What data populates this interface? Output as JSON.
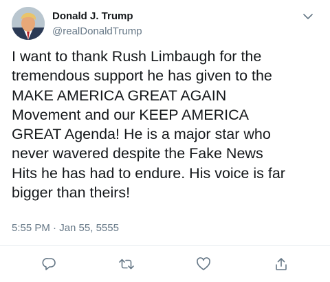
{
  "tweet": {
    "author": {
      "name": "Donald J. Trump",
      "handle": "@realDonaldTrump",
      "avatar_icon": "profile-photo"
    },
    "text": "I want to thank Rush Limbaugh for the\ntremendous support he has given to the\nMAKE AMERICA GREAT AGAIN\nMovement and our KEEP AMERICA\nGREAT Agenda! He is a major star who\nnever wavered despite the Fake News\nHits he has had to endure. His voice is far\nbigger than theirs!",
    "timestamp": "5:55 PM · Jan 55, 5555",
    "menu_icon": "chevron-down-icon",
    "actions": [
      {
        "name": "reply",
        "icon": "reply-icon"
      },
      {
        "name": "retweet",
        "icon": "retweet-icon"
      },
      {
        "name": "like",
        "icon": "heart-icon"
      },
      {
        "name": "share",
        "icon": "share-icon"
      }
    ]
  },
  "colors": {
    "text": "#14171a",
    "secondary_text": "#657786",
    "icon": "#657786",
    "divider": "#e6ecf0"
  }
}
